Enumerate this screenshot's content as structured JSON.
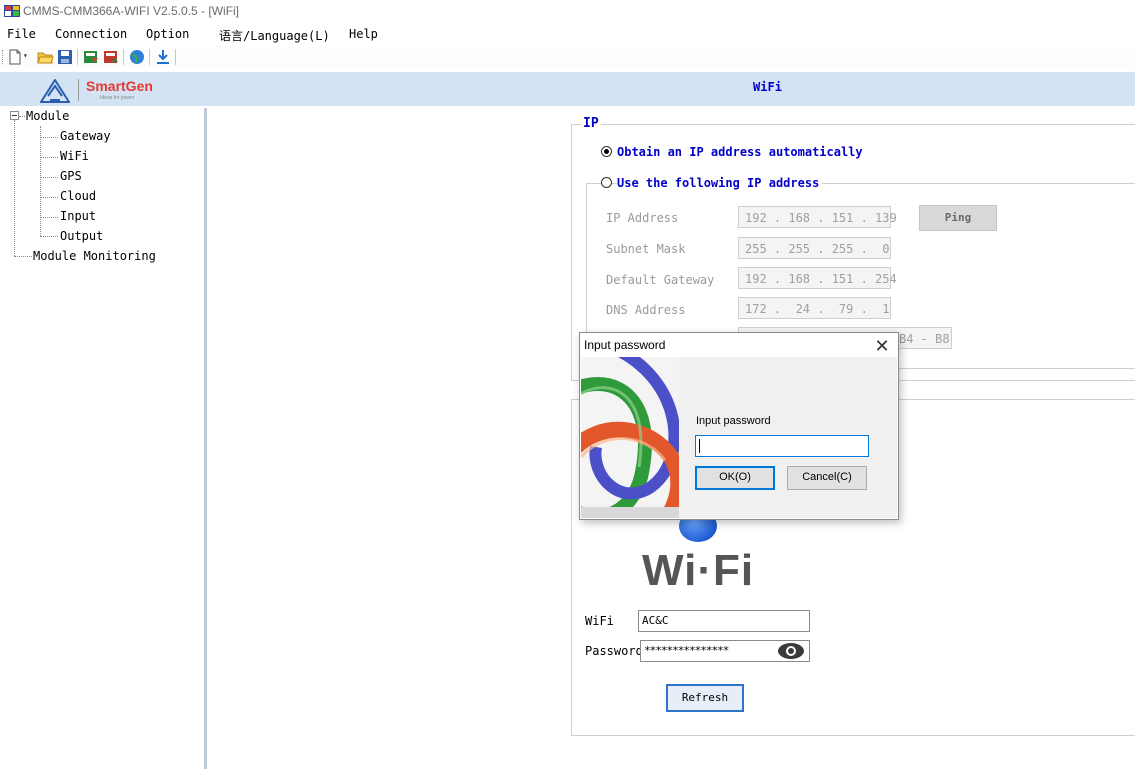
{
  "window": {
    "title": "CMMS-CMM366A-WIFI V2.5.0.5 - [WiFi]"
  },
  "menu": [
    "File",
    "Connection",
    "Option",
    "语言/Language(L)",
    "Help"
  ],
  "toolbar": [
    "new-icon",
    "open-folder-icon",
    "save-icon",
    "read-params-icon",
    "write-params-icon",
    "globe-icon",
    "download-icon"
  ],
  "brand": {
    "name": "SmartGen",
    "tagline": "Ideas for power",
    "accent": "#e23a33"
  },
  "header": {
    "title": "WiFi",
    "band_color": "#d4e3f4"
  },
  "tree": {
    "root": "Module",
    "children": [
      "Gateway",
      "WiFi",
      "GPS",
      "Cloud",
      "Input",
      "Output"
    ],
    "sibling": "Module Monitoring"
  },
  "ip": {
    "legend": "IP",
    "auto_label": "Obtain an IP address automatically",
    "manual_label": "Use the following IP address",
    "selected": "auto",
    "fields": [
      {
        "label": "IP Address",
        "value": "192 . 168 . 151 . 139"
      },
      {
        "label": "Subnet Mask",
        "value": "255 . 255 . 255 .  0"
      },
      {
        "label": "Default Gateway",
        "value": "192 . 168 . 151 . 254"
      },
      {
        "label": "DNS Address",
        "value": "172 .  24 .  79 .  1"
      }
    ],
    "mac_partial": "B4 - B8",
    "ping_label": "Ping"
  },
  "wifi": {
    "logo_text": "Wi·Fi",
    "ssid_label": "WiFi",
    "ssid_value": "AC&C",
    "password_label": "Password",
    "password_value": "***************",
    "refresh_label": "Refresh"
  },
  "dialog": {
    "title": "Input password",
    "prompt": "Input password",
    "input_value": "",
    "ok_label": "OK(O)",
    "cancel_label": "Cancel(C)",
    "close_glyph": "✕"
  }
}
